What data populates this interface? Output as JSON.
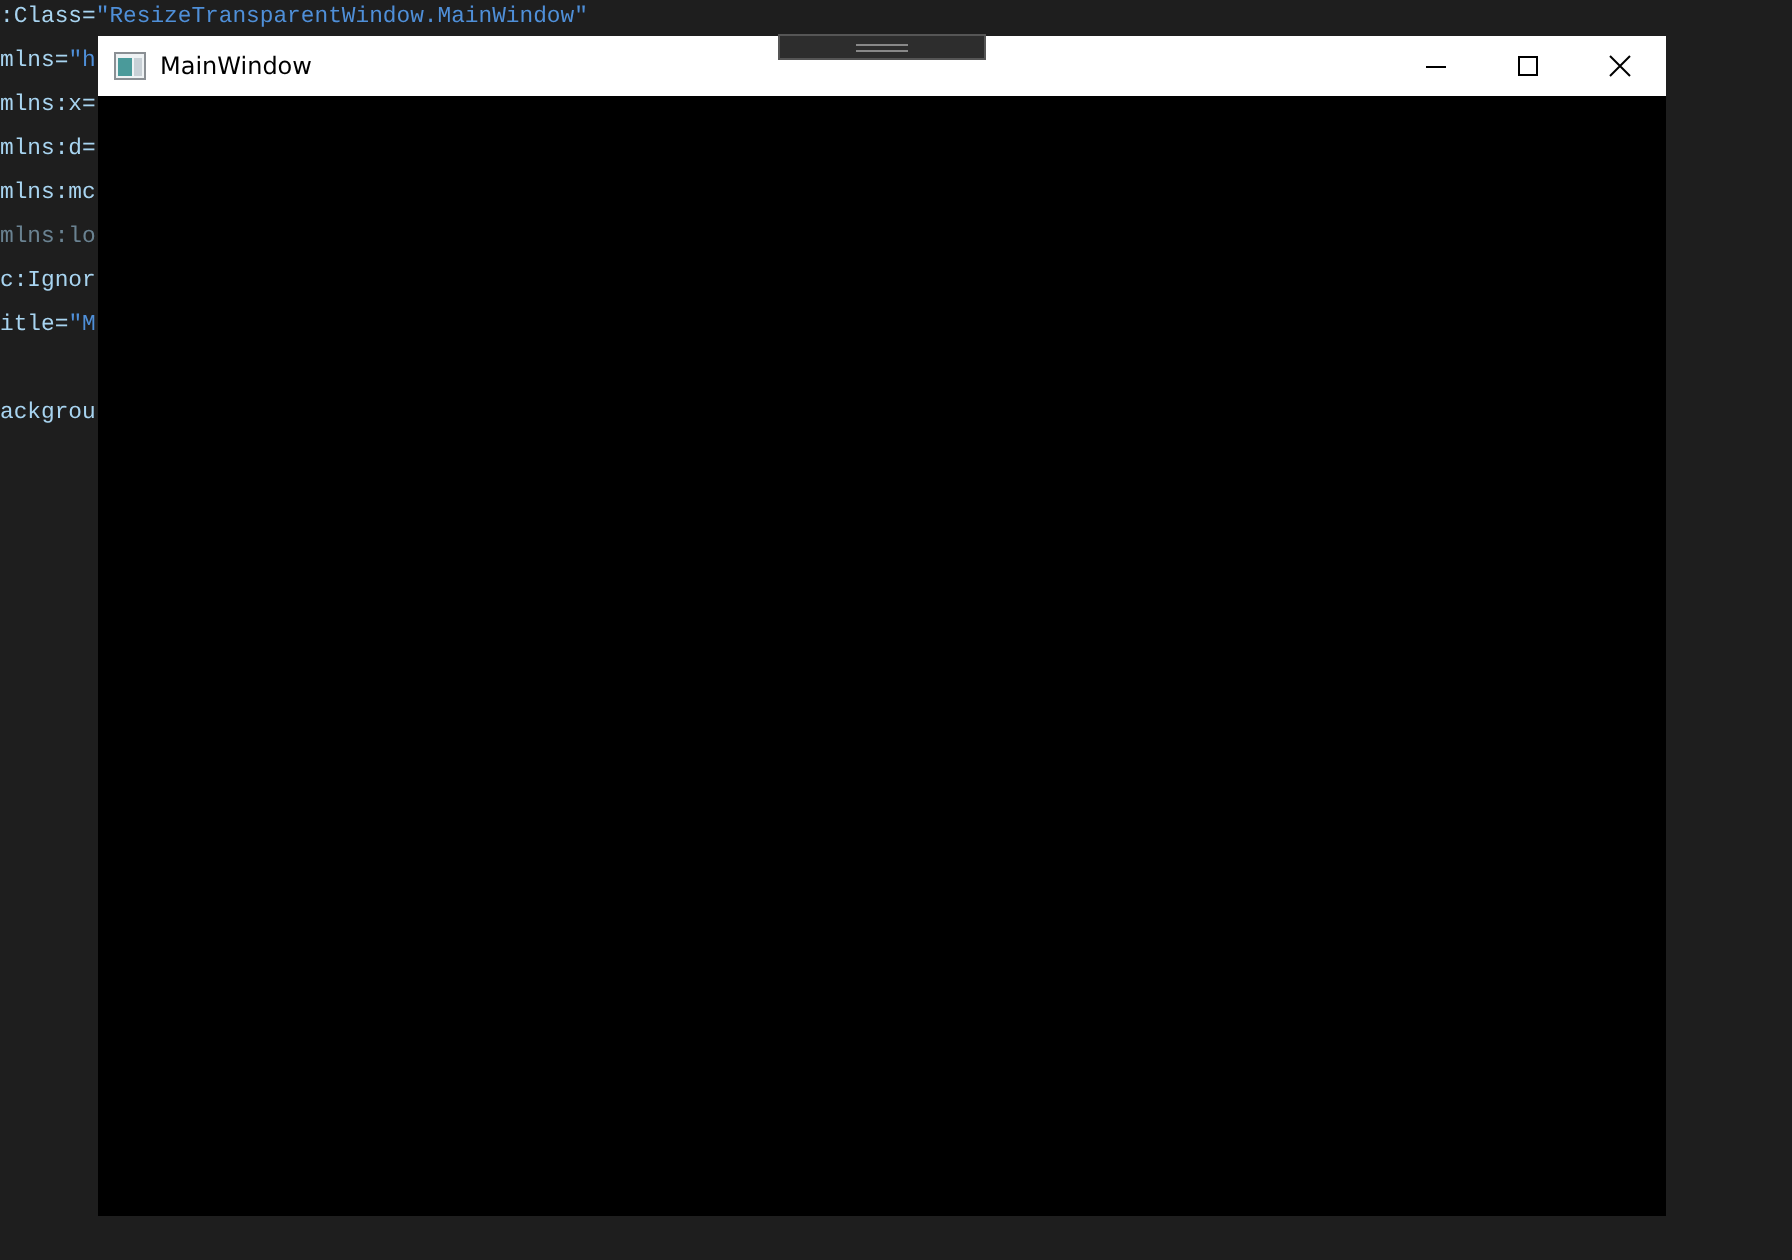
{
  "editor": {
    "lines": [
      {
        "kind": "code",
        "attr": ":Class=",
        "value": "\"ResizeTransparentWindow.MainWindow\"",
        "faded": false
      },
      {
        "kind": "code",
        "attr": "mlns=",
        "value": "\"h",
        "faded": false
      },
      {
        "kind": "code",
        "attr": "mlns:x=",
        "faded": false
      },
      {
        "kind": "code",
        "attr": "mlns:d=",
        "faded": false
      },
      {
        "kind": "code",
        "attr": "mlns:mc",
        "faded": false
      },
      {
        "kind": "code",
        "attr": "mlns:lo",
        "faded": true
      },
      {
        "kind": "code",
        "attr": "c:Ignor",
        "faded": false
      },
      {
        "kind": "code",
        "attr": "itle=",
        "value": "\"M",
        "faded": false
      },
      {
        "kind": "blank"
      },
      {
        "kind": "code",
        "attr": "ackgrou",
        "faded": false
      }
    ]
  },
  "window": {
    "title": "MainWindow"
  }
}
